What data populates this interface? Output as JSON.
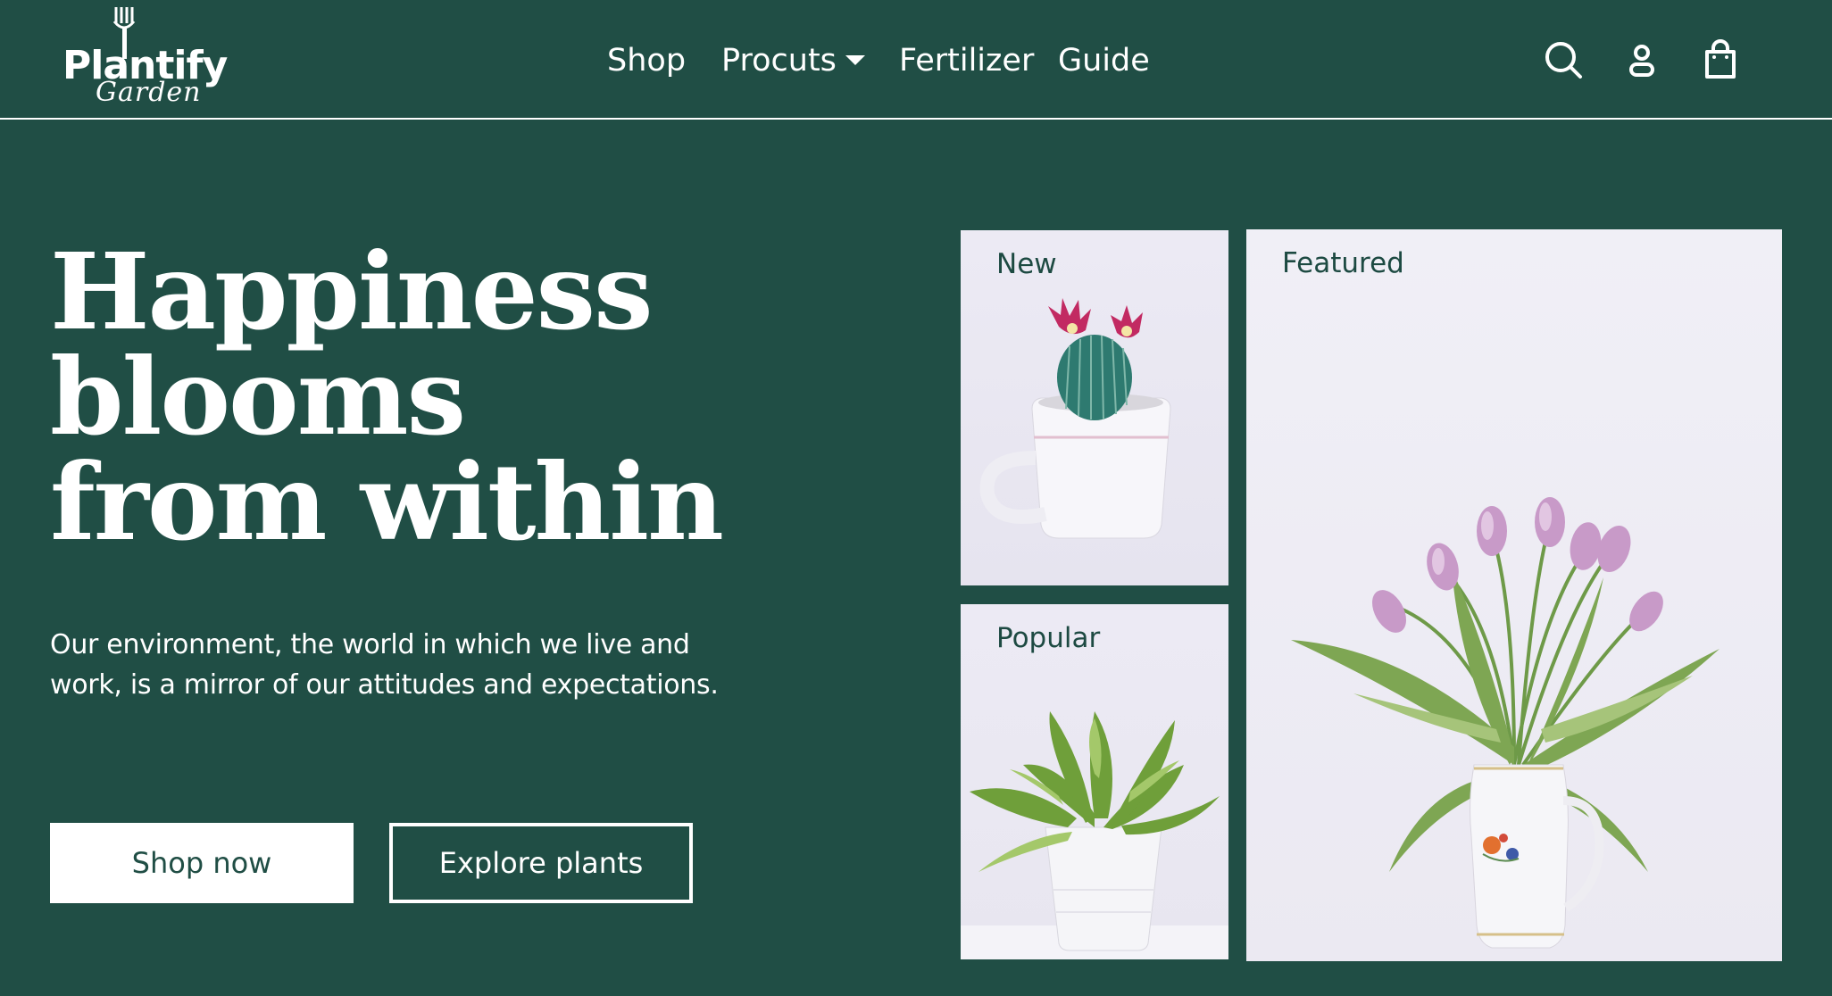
{
  "brand": {
    "name": "Plantify",
    "subtitle": "Garden"
  },
  "nav": {
    "items": [
      "Shop",
      "Procuts",
      "Fertilizer",
      "Guide"
    ]
  },
  "header_icons": [
    "search-icon",
    "user-icon",
    "shopping-bag-icon"
  ],
  "hero": {
    "title_lines": [
      "Happiness",
      "blooms",
      "from within"
    ],
    "description": "Our environment, the world in which we live and work, is a mirror of our attitudes and expectations.",
    "primary_button": "Shop now",
    "secondary_button": "Explore plants"
  },
  "cards": {
    "new": {
      "label": "New"
    },
    "popular": {
      "label": "Popular"
    },
    "featured": {
      "label": "Featured"
    }
  },
  "colors": {
    "background": "#204e45",
    "text": "#ffffff",
    "card_label": "#1d4a42"
  }
}
